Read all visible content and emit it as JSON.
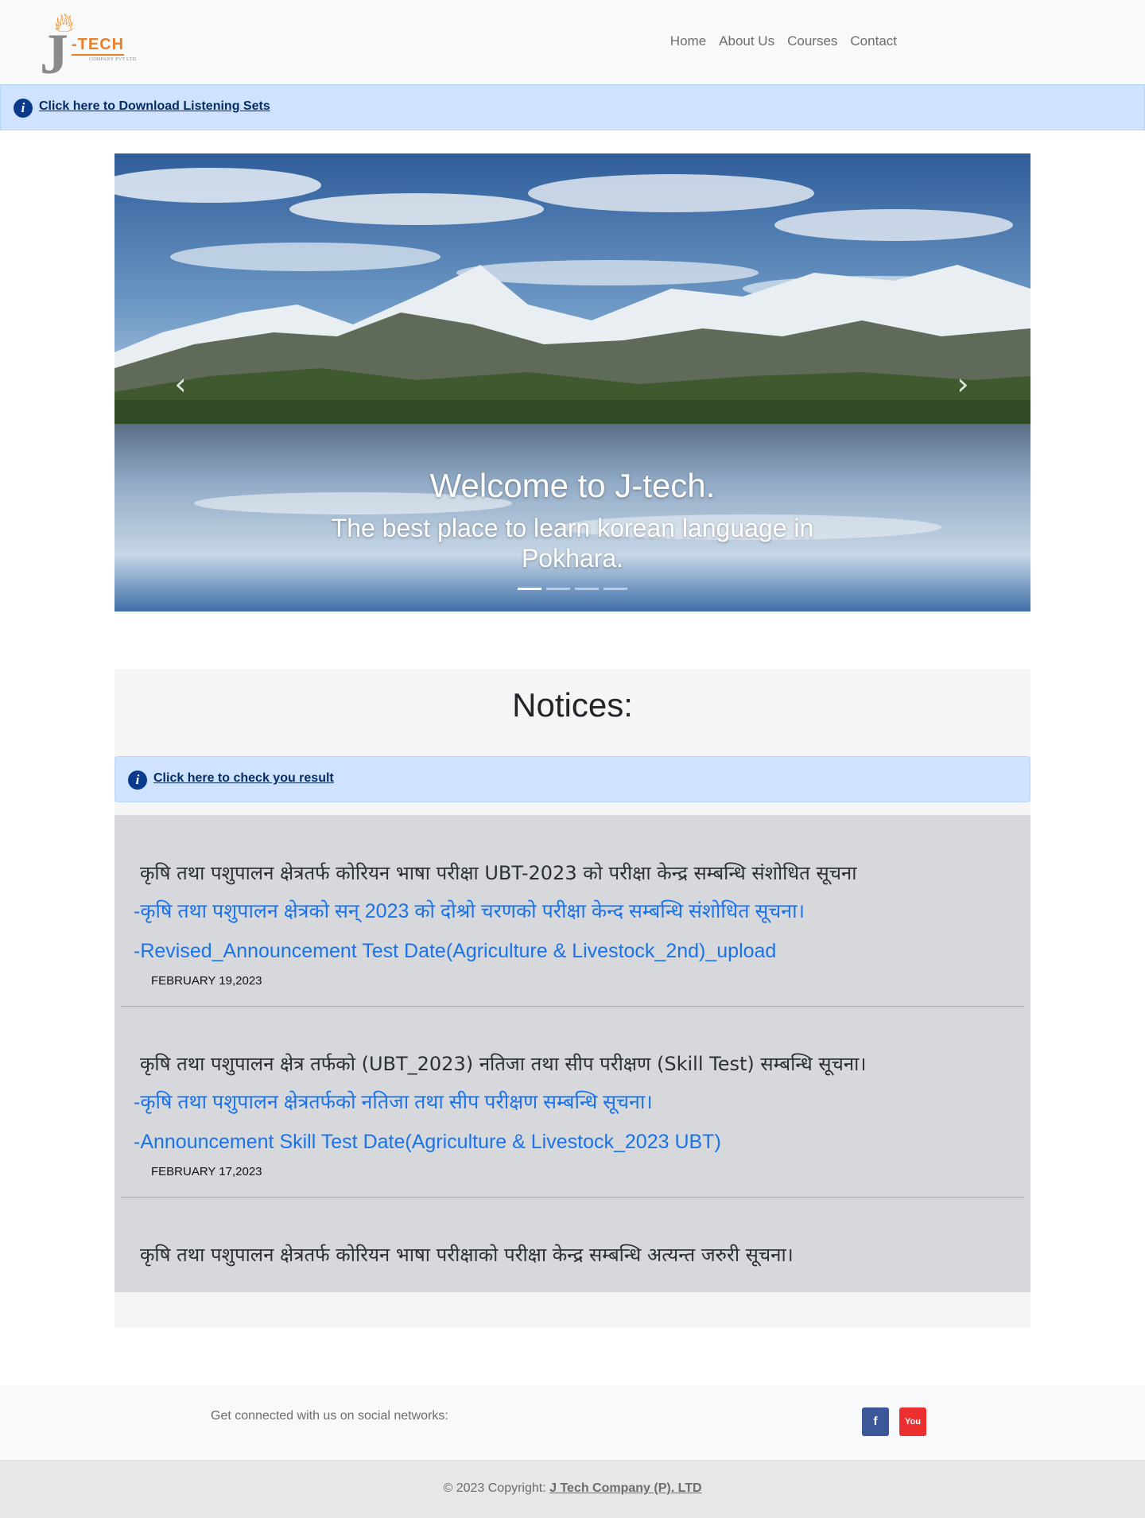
{
  "brand": {
    "logo_text": "-TECH",
    "logo_letter": "J",
    "logo_subtitle": "COMPANY PVT LTD."
  },
  "nav": {
    "items": [
      "Home",
      "About Us",
      "Courses",
      "Contact"
    ]
  },
  "top_alert": {
    "icon": "info-icon",
    "link_text": "Click here to Download Listening Sets"
  },
  "carousel": {
    "prev_icon": "chevron-left-icon",
    "next_icon": "chevron-right-icon",
    "title": "Welcome to J-tech.",
    "subtitle": "The best place to learn korean language in Pokhara.",
    "slide_count": 4,
    "active_slide": 1
  },
  "notices": {
    "heading": "Notices:",
    "result_alert": {
      "icon": "info-icon",
      "link_text": "Click here to check you result"
    },
    "items": [
      {
        "title": "कृषि तथा पशुपालन क्षेत्रतर्फ कोरियन भाषा परीक्षा UBT-2023 को परीक्षा केन्द्र सम्बन्धि संशोधित सूचना",
        "link1": "-कृषि तथा पशुपालन क्षेत्रको सन् 2023 को दोश्रो चरणको परीक्षा केन्द सम्बन्धि संशोधित सूचना।",
        "link2": "-Revised_Announcement Test Date(Agriculture & Livestock_2nd)_upload",
        "date": "FEBRUARY 19,2023"
      },
      {
        "title": "कृषि तथा पशुपालन क्षेत्र तर्फको (UBT_2023) नतिजा तथा सीप परीक्षण (Skill Test) सम्बन्धि सूचना।",
        "link1": "-कृषि तथा पशुपालन क्षेत्रतर्फको नतिजा तथा सीप परीक्षण सम्बन्धि सूचना।",
        "link2": "-Announcement Skill Test Date(Agriculture & Livestock_2023 UBT)",
        "date": "FEBRUARY 17,2023"
      },
      {
        "title": "कृषि तथा पशुपालन क्षेत्रतर्फ कोरियन भाषा परीक्षाको परीक्षा केन्द्र सम्बन्धि अत्यन्त जरुरी सूचना।",
        "link1": "",
        "link2": "",
        "date": ""
      }
    ]
  },
  "footer": {
    "social_text": "Get connected with us on social networks:",
    "social_icons": [
      "facebook-icon",
      "youtube-icon"
    ],
    "facebook_glyph": "f",
    "youtube_glyph": "You",
    "copyright_prefix": "© 2023 Copyright: ",
    "copyright_link": "J Tech Company (P). LTD"
  },
  "colors": {
    "alert_bg": "#cfe2ff",
    "alert_text": "#052c65",
    "link_blue": "#1a73e8",
    "notice_bg": "#d6d8db",
    "facebook": "#3b5998",
    "youtube": "#ed302f"
  }
}
